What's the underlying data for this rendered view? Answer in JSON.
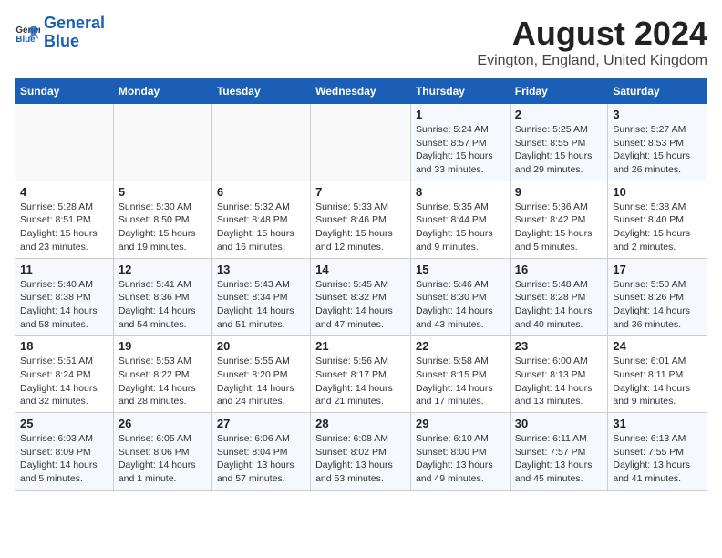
{
  "header": {
    "logo_text1": "General",
    "logo_text2": "Blue",
    "month_year": "August 2024",
    "location": "Evington, England, United Kingdom"
  },
  "days_of_week": [
    "Sunday",
    "Monday",
    "Tuesday",
    "Wednesday",
    "Thursday",
    "Friday",
    "Saturday"
  ],
  "weeks": [
    [
      {
        "day": "",
        "info": ""
      },
      {
        "day": "",
        "info": ""
      },
      {
        "day": "",
        "info": ""
      },
      {
        "day": "",
        "info": ""
      },
      {
        "day": "1",
        "info": "Sunrise: 5:24 AM\nSunset: 8:57 PM\nDaylight: 15 hours\nand 33 minutes."
      },
      {
        "day": "2",
        "info": "Sunrise: 5:25 AM\nSunset: 8:55 PM\nDaylight: 15 hours\nand 29 minutes."
      },
      {
        "day": "3",
        "info": "Sunrise: 5:27 AM\nSunset: 8:53 PM\nDaylight: 15 hours\nand 26 minutes."
      }
    ],
    [
      {
        "day": "4",
        "info": "Sunrise: 5:28 AM\nSunset: 8:51 PM\nDaylight: 15 hours\nand 23 minutes."
      },
      {
        "day": "5",
        "info": "Sunrise: 5:30 AM\nSunset: 8:50 PM\nDaylight: 15 hours\nand 19 minutes."
      },
      {
        "day": "6",
        "info": "Sunrise: 5:32 AM\nSunset: 8:48 PM\nDaylight: 15 hours\nand 16 minutes."
      },
      {
        "day": "7",
        "info": "Sunrise: 5:33 AM\nSunset: 8:46 PM\nDaylight: 15 hours\nand 12 minutes."
      },
      {
        "day": "8",
        "info": "Sunrise: 5:35 AM\nSunset: 8:44 PM\nDaylight: 15 hours\nand 9 minutes."
      },
      {
        "day": "9",
        "info": "Sunrise: 5:36 AM\nSunset: 8:42 PM\nDaylight: 15 hours\nand 5 minutes."
      },
      {
        "day": "10",
        "info": "Sunrise: 5:38 AM\nSunset: 8:40 PM\nDaylight: 15 hours\nand 2 minutes."
      }
    ],
    [
      {
        "day": "11",
        "info": "Sunrise: 5:40 AM\nSunset: 8:38 PM\nDaylight: 14 hours\nand 58 minutes."
      },
      {
        "day": "12",
        "info": "Sunrise: 5:41 AM\nSunset: 8:36 PM\nDaylight: 14 hours\nand 54 minutes."
      },
      {
        "day": "13",
        "info": "Sunrise: 5:43 AM\nSunset: 8:34 PM\nDaylight: 14 hours\nand 51 minutes."
      },
      {
        "day": "14",
        "info": "Sunrise: 5:45 AM\nSunset: 8:32 PM\nDaylight: 14 hours\nand 47 minutes."
      },
      {
        "day": "15",
        "info": "Sunrise: 5:46 AM\nSunset: 8:30 PM\nDaylight: 14 hours\nand 43 minutes."
      },
      {
        "day": "16",
        "info": "Sunrise: 5:48 AM\nSunset: 8:28 PM\nDaylight: 14 hours\nand 40 minutes."
      },
      {
        "day": "17",
        "info": "Sunrise: 5:50 AM\nSunset: 8:26 PM\nDaylight: 14 hours\nand 36 minutes."
      }
    ],
    [
      {
        "day": "18",
        "info": "Sunrise: 5:51 AM\nSunset: 8:24 PM\nDaylight: 14 hours\nand 32 minutes."
      },
      {
        "day": "19",
        "info": "Sunrise: 5:53 AM\nSunset: 8:22 PM\nDaylight: 14 hours\nand 28 minutes."
      },
      {
        "day": "20",
        "info": "Sunrise: 5:55 AM\nSunset: 8:20 PM\nDaylight: 14 hours\nand 24 minutes."
      },
      {
        "day": "21",
        "info": "Sunrise: 5:56 AM\nSunset: 8:17 PM\nDaylight: 14 hours\nand 21 minutes."
      },
      {
        "day": "22",
        "info": "Sunrise: 5:58 AM\nSunset: 8:15 PM\nDaylight: 14 hours\nand 17 minutes."
      },
      {
        "day": "23",
        "info": "Sunrise: 6:00 AM\nSunset: 8:13 PM\nDaylight: 14 hours\nand 13 minutes."
      },
      {
        "day": "24",
        "info": "Sunrise: 6:01 AM\nSunset: 8:11 PM\nDaylight: 14 hours\nand 9 minutes."
      }
    ],
    [
      {
        "day": "25",
        "info": "Sunrise: 6:03 AM\nSunset: 8:09 PM\nDaylight: 14 hours\nand 5 minutes."
      },
      {
        "day": "26",
        "info": "Sunrise: 6:05 AM\nSunset: 8:06 PM\nDaylight: 14 hours\nand 1 minute."
      },
      {
        "day": "27",
        "info": "Sunrise: 6:06 AM\nSunset: 8:04 PM\nDaylight: 13 hours\nand 57 minutes."
      },
      {
        "day": "28",
        "info": "Sunrise: 6:08 AM\nSunset: 8:02 PM\nDaylight: 13 hours\nand 53 minutes."
      },
      {
        "day": "29",
        "info": "Sunrise: 6:10 AM\nSunset: 8:00 PM\nDaylight: 13 hours\nand 49 minutes."
      },
      {
        "day": "30",
        "info": "Sunrise: 6:11 AM\nSunset: 7:57 PM\nDaylight: 13 hours\nand 45 minutes."
      },
      {
        "day": "31",
        "info": "Sunrise: 6:13 AM\nSunset: 7:55 PM\nDaylight: 13 hours\nand 41 minutes."
      }
    ]
  ]
}
